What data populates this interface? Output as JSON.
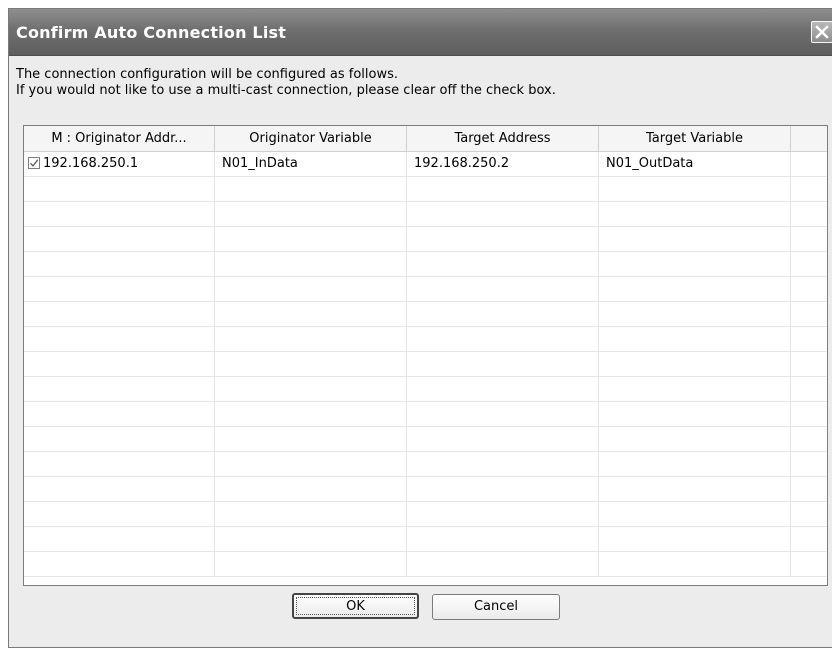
{
  "window": {
    "title": "Confirm Auto Connection List",
    "close_icon": "close-icon"
  },
  "intro": {
    "line1": "The connection configuration will be configured as follows.",
    "line2": "If you would not like to use a multi-cast connection, please clear off the check box."
  },
  "table": {
    "headers": [
      "M : Originator Addr...",
      "Originator Variable",
      "Target Address",
      "Target Variable"
    ],
    "rows": [
      {
        "checked": true,
        "originator_address": "192.168.250.1",
        "originator_variable": "N01_InData",
        "target_address": "192.168.250.2",
        "target_variable": "N01_OutData"
      }
    ]
  },
  "buttons": {
    "ok": "OK",
    "cancel": "Cancel"
  }
}
